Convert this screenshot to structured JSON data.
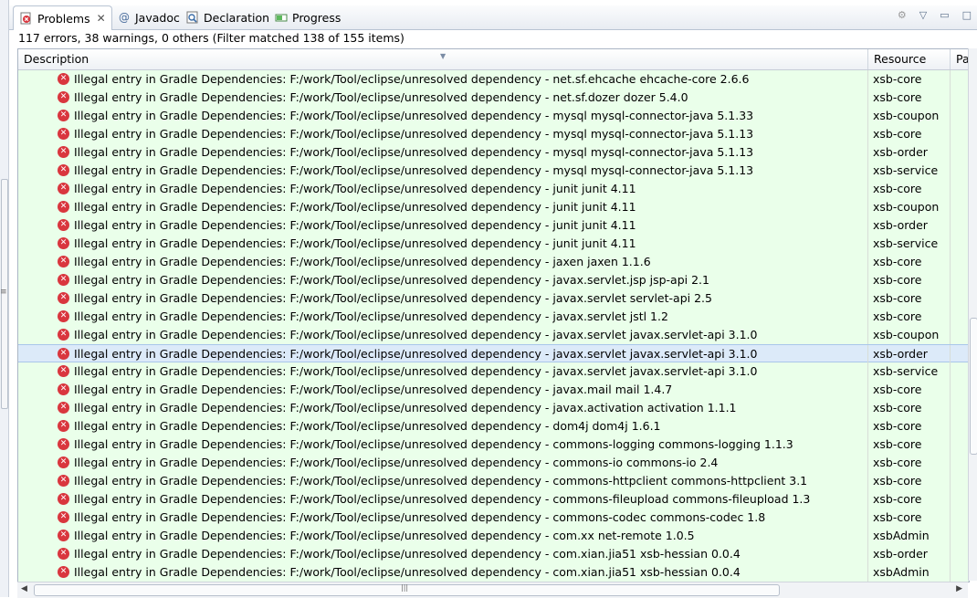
{
  "tabs": [
    {
      "label": "Problems",
      "icon": "problems-icon",
      "active": true
    },
    {
      "label": "Javadoc",
      "icon": "javadoc-icon"
    },
    {
      "label": "Declaration",
      "icon": "declaration-icon"
    },
    {
      "label": "Progress",
      "icon": "progress-icon"
    }
  ],
  "summary": "117 errors, 38 warnings, 0 others (Filter matched 138 of 155 items)",
  "columns": {
    "description": "Description",
    "resource": "Resource",
    "path": "Pa"
  },
  "selected_row_index": 15,
  "rows": [
    {
      "desc": "Illegal entry in Gradle Dependencies: F:/work/Tool/eclipse/unresolved dependency - net.sf.ehcache ehcache-core 2.6.6",
      "res": "xsb-core"
    },
    {
      "desc": "Illegal entry in Gradle Dependencies: F:/work/Tool/eclipse/unresolved dependency - net.sf.dozer dozer 5.4.0",
      "res": "xsb-core"
    },
    {
      "desc": "Illegal entry in Gradle Dependencies: F:/work/Tool/eclipse/unresolved dependency - mysql mysql-connector-java 5.1.33",
      "res": "xsb-coupon"
    },
    {
      "desc": "Illegal entry in Gradle Dependencies: F:/work/Tool/eclipse/unresolved dependency - mysql mysql-connector-java 5.1.13",
      "res": "xsb-core"
    },
    {
      "desc": "Illegal entry in Gradle Dependencies: F:/work/Tool/eclipse/unresolved dependency - mysql mysql-connector-java 5.1.13",
      "res": "xsb-order"
    },
    {
      "desc": "Illegal entry in Gradle Dependencies: F:/work/Tool/eclipse/unresolved dependency - mysql mysql-connector-java 5.1.13",
      "res": "xsb-service"
    },
    {
      "desc": "Illegal entry in Gradle Dependencies: F:/work/Tool/eclipse/unresolved dependency - junit junit 4.11",
      "res": "xsb-core"
    },
    {
      "desc": "Illegal entry in Gradle Dependencies: F:/work/Tool/eclipse/unresolved dependency - junit junit 4.11",
      "res": "xsb-coupon"
    },
    {
      "desc": "Illegal entry in Gradle Dependencies: F:/work/Tool/eclipse/unresolved dependency - junit junit 4.11",
      "res": "xsb-order"
    },
    {
      "desc": "Illegal entry in Gradle Dependencies: F:/work/Tool/eclipse/unresolved dependency - junit junit 4.11",
      "res": "xsb-service"
    },
    {
      "desc": "Illegal entry in Gradle Dependencies: F:/work/Tool/eclipse/unresolved dependency - jaxen jaxen 1.1.6",
      "res": "xsb-core"
    },
    {
      "desc": "Illegal entry in Gradle Dependencies: F:/work/Tool/eclipse/unresolved dependency - javax.servlet.jsp jsp-api 2.1",
      "res": "xsb-core"
    },
    {
      "desc": "Illegal entry in Gradle Dependencies: F:/work/Tool/eclipse/unresolved dependency - javax.servlet servlet-api 2.5",
      "res": "xsb-core"
    },
    {
      "desc": "Illegal entry in Gradle Dependencies: F:/work/Tool/eclipse/unresolved dependency - javax.servlet jstl 1.2",
      "res": "xsb-core"
    },
    {
      "desc": "Illegal entry in Gradle Dependencies: F:/work/Tool/eclipse/unresolved dependency - javax.servlet javax.servlet-api 3.1.0",
      "res": "xsb-coupon"
    },
    {
      "desc": "Illegal entry in Gradle Dependencies: F:/work/Tool/eclipse/unresolved dependency - javax.servlet javax.servlet-api 3.1.0",
      "res": "xsb-order"
    },
    {
      "desc": "Illegal entry in Gradle Dependencies: F:/work/Tool/eclipse/unresolved dependency - javax.servlet javax.servlet-api 3.1.0",
      "res": "xsb-service"
    },
    {
      "desc": "Illegal entry in Gradle Dependencies: F:/work/Tool/eclipse/unresolved dependency - javax.mail mail 1.4.7",
      "res": "xsb-core"
    },
    {
      "desc": "Illegal entry in Gradle Dependencies: F:/work/Tool/eclipse/unresolved dependency - javax.activation activation 1.1.1",
      "res": "xsb-core"
    },
    {
      "desc": "Illegal entry in Gradle Dependencies: F:/work/Tool/eclipse/unresolved dependency - dom4j dom4j 1.6.1",
      "res": "xsb-core"
    },
    {
      "desc": "Illegal entry in Gradle Dependencies: F:/work/Tool/eclipse/unresolved dependency - commons-logging commons-logging 1.1.3",
      "res": "xsb-core"
    },
    {
      "desc": "Illegal entry in Gradle Dependencies: F:/work/Tool/eclipse/unresolved dependency - commons-io commons-io 2.4",
      "res": "xsb-core"
    },
    {
      "desc": "Illegal entry in Gradle Dependencies: F:/work/Tool/eclipse/unresolved dependency - commons-httpclient commons-httpclient 3.1",
      "res": "xsb-core"
    },
    {
      "desc": "Illegal entry in Gradle Dependencies: F:/work/Tool/eclipse/unresolved dependency - commons-fileupload commons-fileupload 1.3",
      "res": "xsb-core"
    },
    {
      "desc": "Illegal entry in Gradle Dependencies: F:/work/Tool/eclipse/unresolved dependency - commons-codec commons-codec 1.8",
      "res": "xsb-core"
    },
    {
      "desc": "Illegal entry in Gradle Dependencies: F:/work/Tool/eclipse/unresolved dependency - com.xx net-remote 1.0.5",
      "res": "xsbAdmin"
    },
    {
      "desc": "Illegal entry in Gradle Dependencies: F:/work/Tool/eclipse/unresolved dependency - com.xian.jia51 xsb-hessian 0.0.4",
      "res": "xsb-order"
    },
    {
      "desc": "Illegal entry in Gradle Dependencies: F:/work/Tool/eclipse/unresolved dependency - com.xian.jia51 xsb-hessian 0.0.4",
      "res": "xsbAdmin"
    }
  ],
  "colors": {
    "row_bg": "#eaffea",
    "selected_bg": "#dceaf9",
    "error_red": "#d9363e"
  }
}
